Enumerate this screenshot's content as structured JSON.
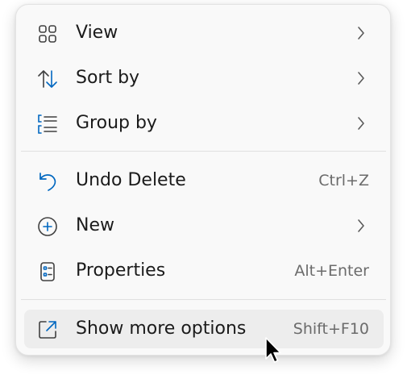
{
  "menu": {
    "items": [
      {
        "label": "View",
        "icon": "grid-view-icon",
        "submenu": true
      },
      {
        "label": "Sort by",
        "icon": "sort-arrows-icon",
        "submenu": true
      },
      {
        "label": "Group by",
        "icon": "group-list-icon",
        "submenu": true
      },
      {
        "label": "Undo Delete",
        "icon": "undo-icon",
        "shortcut": "Ctrl+Z"
      },
      {
        "label": "New",
        "icon": "add-circle-icon",
        "submenu": true
      },
      {
        "label": "Properties",
        "icon": "properties-icon",
        "shortcut": "Alt+Enter"
      },
      {
        "label": "Show more options",
        "icon": "open-external-icon",
        "shortcut": "Shift+F10",
        "hovered": true
      }
    ]
  },
  "colors": {
    "accent": "#0067c0",
    "icon": "#404040",
    "text": "#1b1b1b",
    "shortcut": "#6b6b6b",
    "hover": "#ededed"
  }
}
